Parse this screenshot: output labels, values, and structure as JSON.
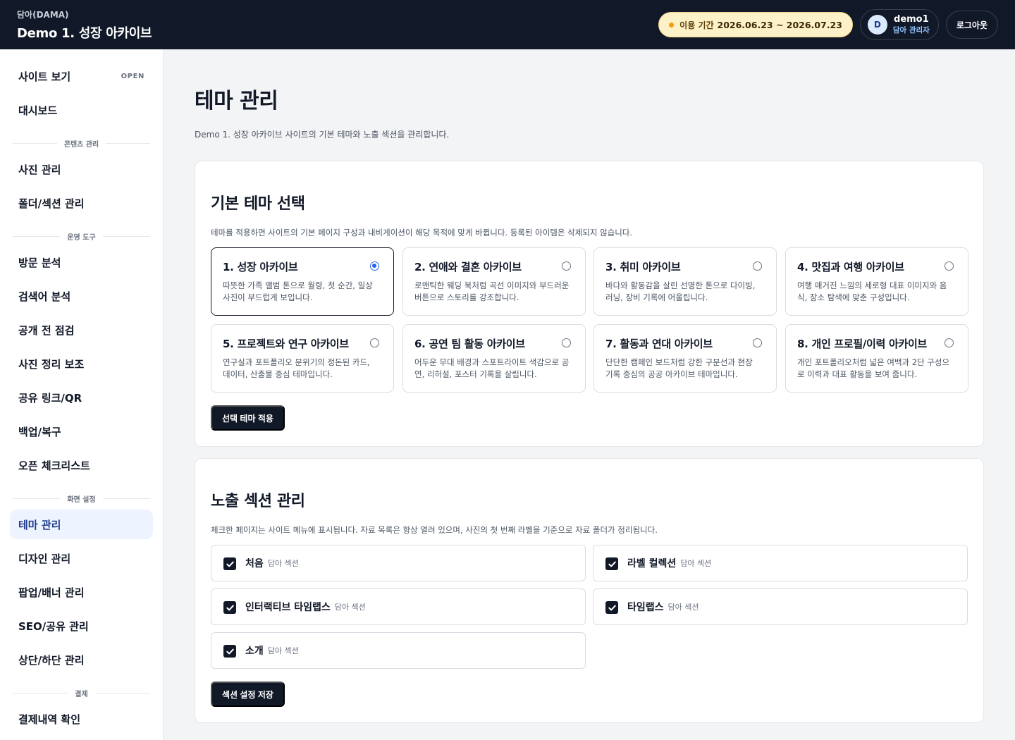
{
  "header": {
    "brand_sub": "담아(DAMA)",
    "brand_title": "Demo 1. 성장 아카이브",
    "period_label": "이용 기간",
    "period_dates": "2026.06.23 ~ 2026.07.23",
    "user_initial": "D",
    "user_name": "demo1",
    "user_role": "담아 관리자",
    "logout_label": "로그아웃"
  },
  "sidebar": {
    "site_view": "사이트 보기",
    "site_view_badge": "OPEN",
    "dashboard": "대시보드",
    "group_content": "콘텐츠 관리",
    "photo": "사진 관리",
    "folder": "폴더/섹션 관리",
    "group_ops": "운영 도구",
    "visit": "방문 분석",
    "search": "검색어 분석",
    "precheck": "공개 전 점검",
    "organize": "사진 정리 보조",
    "share": "공유 링크/QR",
    "backup": "백업/복구",
    "open_check": "오픈 체크리스트",
    "group_screen": "화면 설정",
    "theme": "테마 관리",
    "design": "디자인 관리",
    "popup": "팝업/배너 관리",
    "seo": "SEO/공유 관리",
    "header_footer": "상단/하단 관리",
    "group_payment": "결제",
    "payment": "결제내역 확인"
  },
  "main": {
    "title": "테마 관리",
    "description": "Demo 1. 성장 아카이브 사이트의 기본 테마와 노출 섹션을 관리합니다."
  },
  "theme_card": {
    "title": "기본 테마 선택",
    "description": "테마를 적용하면 사이트의 기본 페이지 구성과 내비게이션이 해당 목적에 맞게 바뀝니다. 등록된 아이템은 삭제되지 않습니다.",
    "themes": [
      {
        "name": "1. 성장 아카이브",
        "desc": "따뜻한 가족 앨범 톤으로 월령, 첫 순간, 일상 사진이 부드럽게 보입니다."
      },
      {
        "name": "2. 연애와 결혼 아카이브",
        "desc": "로맨틱한 웨딩 북처럼 곡선 이미지와 부드러운 버튼으로 스토리를 강조합니다."
      },
      {
        "name": "3. 취미 아카이브",
        "desc": "바다와 활동감을 살린 선명한 톤으로 다이빙, 러닝, 장비 기록에 어울립니다."
      },
      {
        "name": "4. 맛집과 여행 아카이브",
        "desc": "여행 매거진 느낌의 세로형 대표 이미지와 음식, 장소 탐색에 맞춘 구성입니다."
      },
      {
        "name": "5. 프로젝트와 연구 아카이브",
        "desc": "연구실과 포트폴리오 분위기의 정돈된 카드, 데이터, 산출물 중심 테마입니다."
      },
      {
        "name": "6. 공연 팀 활동 아카이브",
        "desc": "어두운 무대 배경과 스포트라이트 색감으로 공연, 리허설, 포스터 기록을 살립니다."
      },
      {
        "name": "7. 활동과 연대 아카이브",
        "desc": "단단한 캠페인 보드처럼 강한 구분선과 현장 기록 중심의 공공 아카이브 테마입니다."
      },
      {
        "name": "8. 개인 프로필/이력 아카이브",
        "desc": "개인 포트폴리오처럼 넓은 여백과 2단 구성으로 이력과 대표 활동을 보여 줍니다."
      }
    ],
    "selected_index": 0,
    "apply_label": "선택 테마 적용"
  },
  "section_card": {
    "title": "노출 섹션 관리",
    "description": "체크한 페이지는 사이트 메뉴에 표시됩니다. 자료 목록은 항상 열려 있으며, 사진의 첫 번째 라벨을 기준으로 자료 폴더가 정리됩니다.",
    "sections": [
      {
        "name": "처음",
        "tag": "담아 섹션",
        "checked": true
      },
      {
        "name": "라벨 컬렉션",
        "tag": "담아 섹션",
        "checked": true
      },
      {
        "name": "인터랙티브 타임랩스",
        "tag": "담아 섹션",
        "checked": true
      },
      {
        "name": "타임랩스",
        "tag": "담아 섹션",
        "checked": true
      },
      {
        "name": "소개",
        "tag": "담아 섹션",
        "checked": true
      }
    ],
    "save_label": "섹션 설정 저장"
  }
}
